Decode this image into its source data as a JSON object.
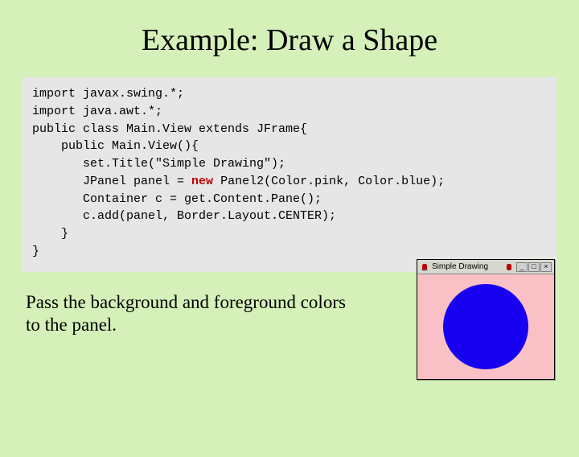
{
  "title": "Example: Draw a Shape",
  "code": {
    "l1": "import javax.swing.*;",
    "l2": "import java.awt.*;",
    "l3": "",
    "l4": "public class Main.View extends JFrame{",
    "l5": "",
    "l6": "    public Main.View(){",
    "l7": "       set.Title(\"Simple Drawing\");",
    "l8a": "       JPanel panel = ",
    "l8kw": "new",
    "l8b": " Panel2(Color.pink, Color.blue);",
    "l9": "       Container c = get.Content.Pane();",
    "l10": "       c.add(panel, Border.Layout.CENTER);",
    "l11": "    }",
    "l12": "}"
  },
  "footnote_line1": "Pass the background and foreground colors",
  "footnote_line2": "to the panel.",
  "window": {
    "title": "Simple Drawing",
    "min": "_",
    "max": "□",
    "close": "×",
    "bg_color": "#f9c0c6",
    "circle_color": "#1800f0"
  }
}
